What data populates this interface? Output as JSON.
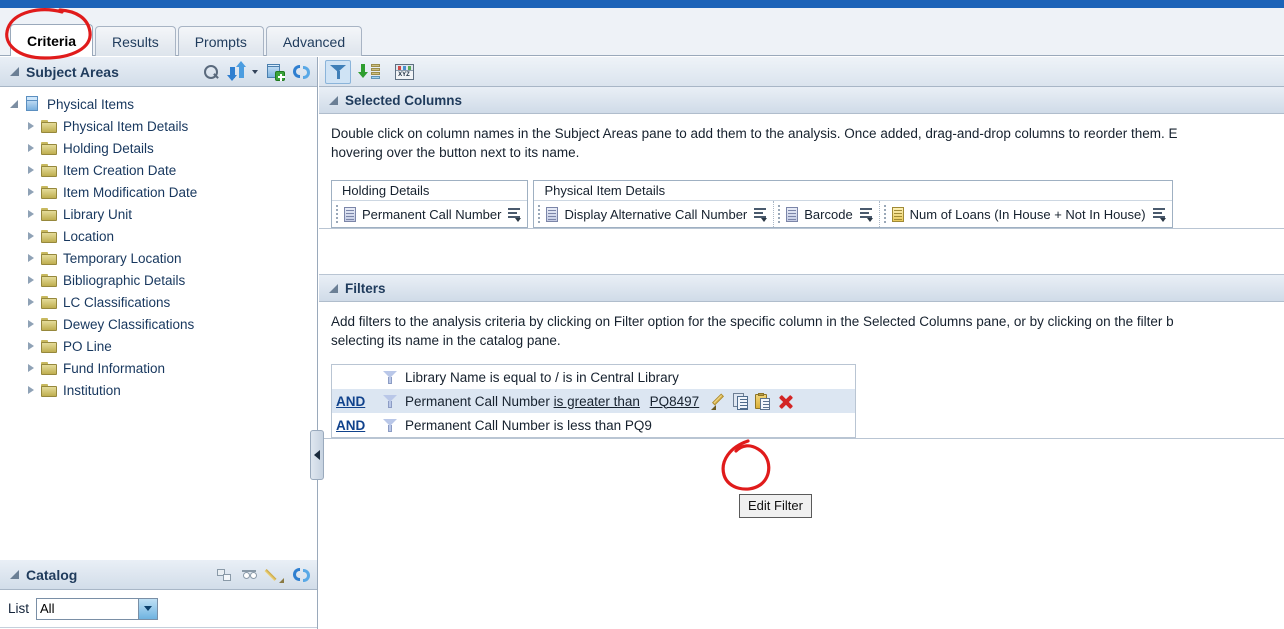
{
  "app": {
    "tabs": [
      {
        "label": "Criteria",
        "active": true
      },
      {
        "label": "Results",
        "active": false
      },
      {
        "label": "Prompts",
        "active": false
      },
      {
        "label": "Advanced",
        "active": false
      }
    ]
  },
  "subject_areas": {
    "title": "Subject Areas",
    "icons": [
      "search-icon",
      "sort-icon",
      "add-subject-area-icon",
      "refresh-icon"
    ],
    "root": "Physical Items",
    "folders": [
      "Physical Item Details",
      "Holding Details",
      "Item Creation Date",
      "Item Modification Date",
      "Library Unit",
      "Location",
      "Temporary Location",
      "Bibliographic Details",
      "LC Classifications",
      "Dewey Classifications",
      "PO Line",
      "Fund Information",
      "Institution"
    ]
  },
  "catalog": {
    "title": "Catalog",
    "icons": [
      "new-object-icon",
      "view-icon",
      "edit-icon",
      "refresh-icon"
    ],
    "list_label": "List",
    "list_value": "All",
    "list_options": [
      "All"
    ]
  },
  "toolbar": {
    "buttons": [
      {
        "name": "filter-button",
        "label": "Filter",
        "selected": true
      },
      {
        "name": "sort-button",
        "label": "Sort",
        "selected": false
      },
      {
        "name": "variables-button",
        "label": "XYZ",
        "selected": false
      }
    ],
    "xyz_label": "XYZ"
  },
  "selected_columns": {
    "title": "Selected Columns",
    "help_text": "Double click on column names in the Subject Areas pane to add them to the analysis. Once added, drag-and-drop columns to reorder them. E",
    "help_text_line2": "hovering over the button next to its name.",
    "groups": [
      {
        "header": "Holding Details",
        "columns": [
          {
            "label": "Permanent Call Number",
            "type": "attribute"
          }
        ]
      },
      {
        "header": "Physical Item Details",
        "columns": [
          {
            "label": "Display Alternative Call Number",
            "type": "attribute"
          },
          {
            "label": "Barcode",
            "type": "attribute"
          },
          {
            "label": "Num of Loans (In House + Not In House)",
            "type": "measure"
          }
        ]
      }
    ]
  },
  "filters": {
    "title": "Filters",
    "help_text": "Add filters to the analysis criteria by clicking on Filter option for the specific column in the Selected Columns pane, or by clicking on the filter b",
    "help_text_line2": "selecting its name in the catalog pane.",
    "rows": [
      {
        "conjunction": "",
        "column": "Library Name",
        "operator": "is equal to / is in",
        "value": "Central Library",
        "highlighted": false
      },
      {
        "conjunction": "AND",
        "column": "Permanent Call Number",
        "operator": "is greater than",
        "value": "PQ8497",
        "highlighted": true
      },
      {
        "conjunction": "AND",
        "column": "Permanent Call Number",
        "operator": "is less than",
        "value": "PQ9",
        "highlighted": false
      }
    ],
    "actions": [
      {
        "name": "edit-filter-icon",
        "label": "Edit Filter"
      },
      {
        "name": "copy-filter-icon",
        "label": "Copy Filter"
      },
      {
        "name": "paste-filter-icon",
        "label": "Paste Filter"
      },
      {
        "name": "delete-filter-icon",
        "label": "Delete Filter"
      }
    ]
  },
  "tooltip": {
    "text": "Edit Filter"
  },
  "colors": {
    "annotation": "#e01b1b",
    "top_bar": "#1c63b8",
    "link": "#10428c",
    "header_text": "#1f3b5c"
  }
}
